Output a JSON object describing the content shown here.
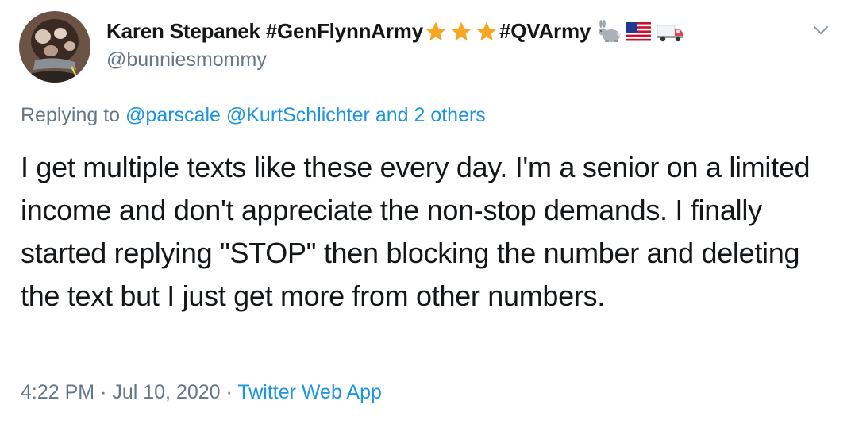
{
  "user": {
    "display_name": "Karen Stepanek #GenFlynnArmy",
    "name_suffix": "#QVArmy",
    "handle": "@bunniesmommy",
    "name_emoji": [
      "star-icon",
      "star-icon",
      "star-icon",
      "rabbit-icon",
      "us-flag-icon",
      "truck-icon"
    ]
  },
  "reply": {
    "prefix": "Replying to ",
    "user1": "@parscale",
    "user2": "@KurtSchlichter",
    "others": "and 2 others"
  },
  "tweet": {
    "text": "I get multiple texts like these every day. I'm a senior on a limited income and don't appreciate the non-stop demands. I finally started replying \"STOP\" then blocking the number and deleting the text but I just get more from other numbers."
  },
  "meta": {
    "time": "4:22 PM",
    "separator": "·",
    "date": "Jul 10, 2020",
    "source": "Twitter Web App"
  },
  "colors": {
    "link": "#1b95e0",
    "secondary_text": "#657786",
    "primary_text": "#14171a",
    "star": "#f5a623"
  }
}
